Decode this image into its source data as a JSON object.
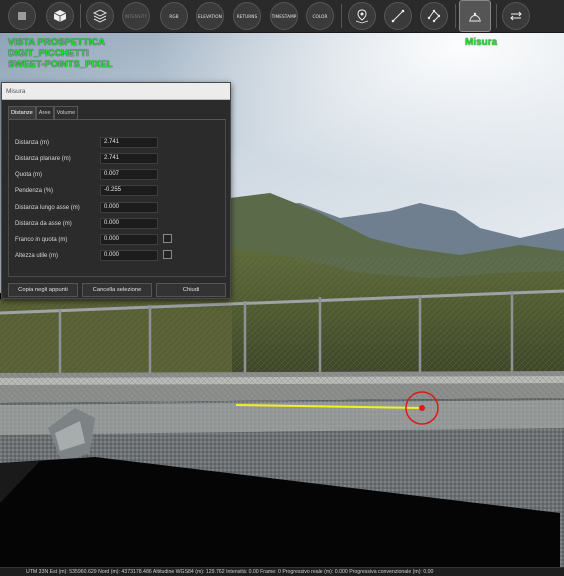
{
  "toolbar": {
    "buttons": [
      {
        "name": "stop-button",
        "kind": "icon",
        "icon": "square-icon"
      },
      {
        "name": "perspective-button",
        "kind": "icon",
        "icon": "cube-icon"
      },
      {
        "name": "pointcloud-button",
        "kind": "icon",
        "icon": "layers-icon"
      },
      {
        "name": "intensity-button",
        "kind": "text",
        "label": "INTENSITY"
      },
      {
        "name": "rgb-button",
        "kind": "text",
        "label": "RGB"
      },
      {
        "name": "elevation-button",
        "kind": "text",
        "label": "ELEVATION"
      },
      {
        "name": "returns-button",
        "kind": "text",
        "label": "RETURNS"
      },
      {
        "name": "timestamp-button",
        "kind": "text",
        "label": "TIMESTAMP"
      },
      {
        "name": "color-button",
        "kind": "text",
        "label": "COLOR"
      },
      {
        "name": "map-pin-button",
        "kind": "icon",
        "icon": "map-pin-icon"
      },
      {
        "name": "line-measure-button",
        "kind": "icon",
        "icon": "line-measure-icon"
      },
      {
        "name": "polyline-measure-button",
        "kind": "icon",
        "icon": "polyline-icon"
      },
      {
        "name": "measure-button",
        "kind": "icon",
        "icon": "measure-icon"
      },
      {
        "name": "swap-button",
        "kind": "icon",
        "icon": "swap-icon"
      }
    ]
  },
  "overlay": {
    "mode_lines": [
      "VISTA PROSPETTICA",
      "DIGIT_PICCHETTI",
      "SWEET-POINTS_PIXEL"
    ],
    "mode_title": "Misura"
  },
  "panel": {
    "title": "Misura",
    "tabs": [
      "Distanze",
      "Aree",
      "Volume"
    ],
    "active_tab": "Distanze",
    "rows": [
      {
        "label": "Distanza (m)",
        "value": "2.741",
        "checkbox": false
      },
      {
        "label": "Distanza planare (m)",
        "value": "2.741",
        "checkbox": false
      },
      {
        "label": "Quota (m)",
        "value": "0.007",
        "checkbox": false
      },
      {
        "label": "Pendenza (%)",
        "value": "-0.255",
        "checkbox": false
      },
      {
        "label": "Distanza lungo asse (m)",
        "value": "0.000",
        "checkbox": false
      },
      {
        "label": "Distanza da asse (m)",
        "value": "0.000",
        "checkbox": false
      },
      {
        "label": "Franco in quota (m)",
        "value": "0.000",
        "checkbox": true
      },
      {
        "label": "Altezza utile (m)",
        "value": "0.000",
        "checkbox": true
      }
    ],
    "buttons": {
      "copy": "Copia negli appunti",
      "clear": "Cancella selezione",
      "close": "Chiudi"
    }
  },
  "statusbar": {
    "text": "UTM 33N   Est (m):  535960.629  Nord (m):  4373178.486  Altitudine WGS84 (m):  129.762  Intensità:  0.00  Frame:  0  Progressivo reale (m):  0.000  Progressiva convenzionale (m):  0.00"
  },
  "colors": {
    "overlay_text": "#2bd83a",
    "measure_line": "#f2f21a",
    "measure_marker": "#e01818"
  }
}
